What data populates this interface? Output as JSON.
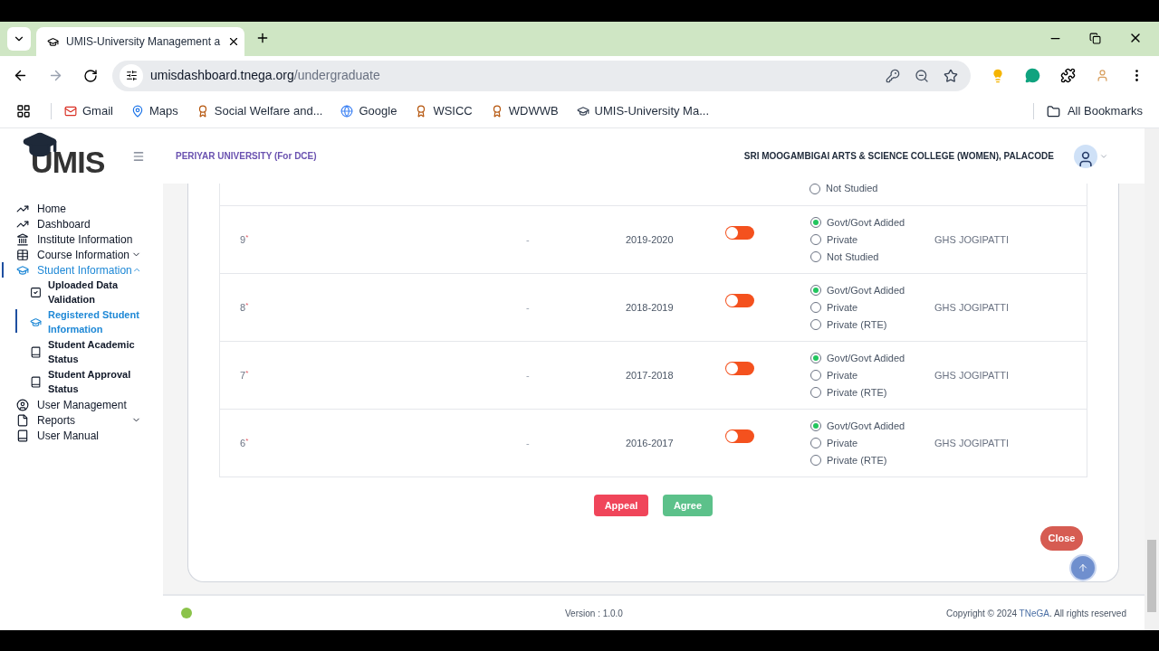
{
  "browser": {
    "tabs": [
      {
        "title": "UMIS-University Management a",
        "selected": true
      }
    ],
    "url": {
      "host": "umisdashboard.tnega.org",
      "path": "/undergraduate"
    },
    "bookmarks": [
      {
        "label": "Gmail"
      },
      {
        "label": "Maps"
      },
      {
        "label": "Social Welfare and..."
      },
      {
        "label": "Google"
      },
      {
        "label": "WSICC"
      },
      {
        "label": "WDWWB"
      },
      {
        "label": "UMIS-University Ma..."
      }
    ],
    "all_bookmarks": "All Bookmarks"
  },
  "sidebar": {
    "logo": "UMIS",
    "items": [
      {
        "label": "Home",
        "selected": false
      },
      {
        "label": "Dashboard",
        "selected": false
      },
      {
        "label": "Institute Information",
        "selected": false
      },
      {
        "label": "Course Information",
        "selected": false,
        "expanded": false
      },
      {
        "label": "Student Information",
        "selected": true,
        "expanded": true,
        "children": [
          {
            "label": "Uploaded Data Validation",
            "selected": false
          },
          {
            "label": "Registered Student Information",
            "selected": true
          },
          {
            "label": "Student Academic Status",
            "selected": false
          },
          {
            "label": "Student Approval Status",
            "selected": false
          }
        ]
      },
      {
        "label": "User Management",
        "selected": false
      },
      {
        "label": "Reports",
        "selected": false,
        "expanded": false
      },
      {
        "label": "User Manual",
        "selected": false
      }
    ]
  },
  "header": {
    "university": "PERIYAR UNIVERSITY (For DCE)",
    "college": "SRI MOOGAMBIGAI ARTS & SCIENCE COLLEGE (WOMEN), PALACODE"
  },
  "partial_row": {
    "options": [
      {
        "label": "Not Studied",
        "selected": false
      }
    ]
  },
  "rows": [
    {
      "class": "9",
      "mark": "*",
      "column_2": "-",
      "year": "2019-2020",
      "on": false,
      "options": [
        {
          "label": "Govt/Govt Adided",
          "selected": true
        },
        {
          "label": "Private",
          "selected": false
        },
        {
          "label": "Not Studied",
          "selected": false
        }
      ],
      "school": "GHS JOGIPATTI"
    },
    {
      "class": "8",
      "mark": "*",
      "column_2": "-",
      "year": "2018-2019",
      "on": false,
      "options": [
        {
          "label": "Govt/Govt Adided",
          "selected": true
        },
        {
          "label": "Private",
          "selected": false
        },
        {
          "label": "Private (RTE)",
          "selected": false
        }
      ],
      "school": "GHS JOGIPATTI"
    },
    {
      "class": "7",
      "mark": "*",
      "column_2": "-",
      "year": "2017-2018",
      "on": false,
      "options": [
        {
          "label": "Govt/Govt Adided",
          "selected": true
        },
        {
          "label": "Private",
          "selected": false
        },
        {
          "label": "Private (RTE)",
          "selected": false
        }
      ],
      "school": "GHS JOGIPATTI"
    },
    {
      "class": "6",
      "mark": "*",
      "column_2": "-",
      "year": "2016-2017",
      "on": false,
      "options": [
        {
          "label": "Govt/Govt Adided",
          "selected": true
        },
        {
          "label": "Private",
          "selected": false
        },
        {
          "label": "Private (RTE)",
          "selected": false
        }
      ],
      "school": "GHS JOGIPATTI"
    }
  ],
  "actions": {
    "appeal": "Appeal",
    "agree": "Agree",
    "close": "Close"
  },
  "footer": {
    "version": "Version : 1.0.0",
    "copyright": "Copyright © 2024",
    "link": "TNeGA",
    "rights": ". All rights reserved"
  }
}
